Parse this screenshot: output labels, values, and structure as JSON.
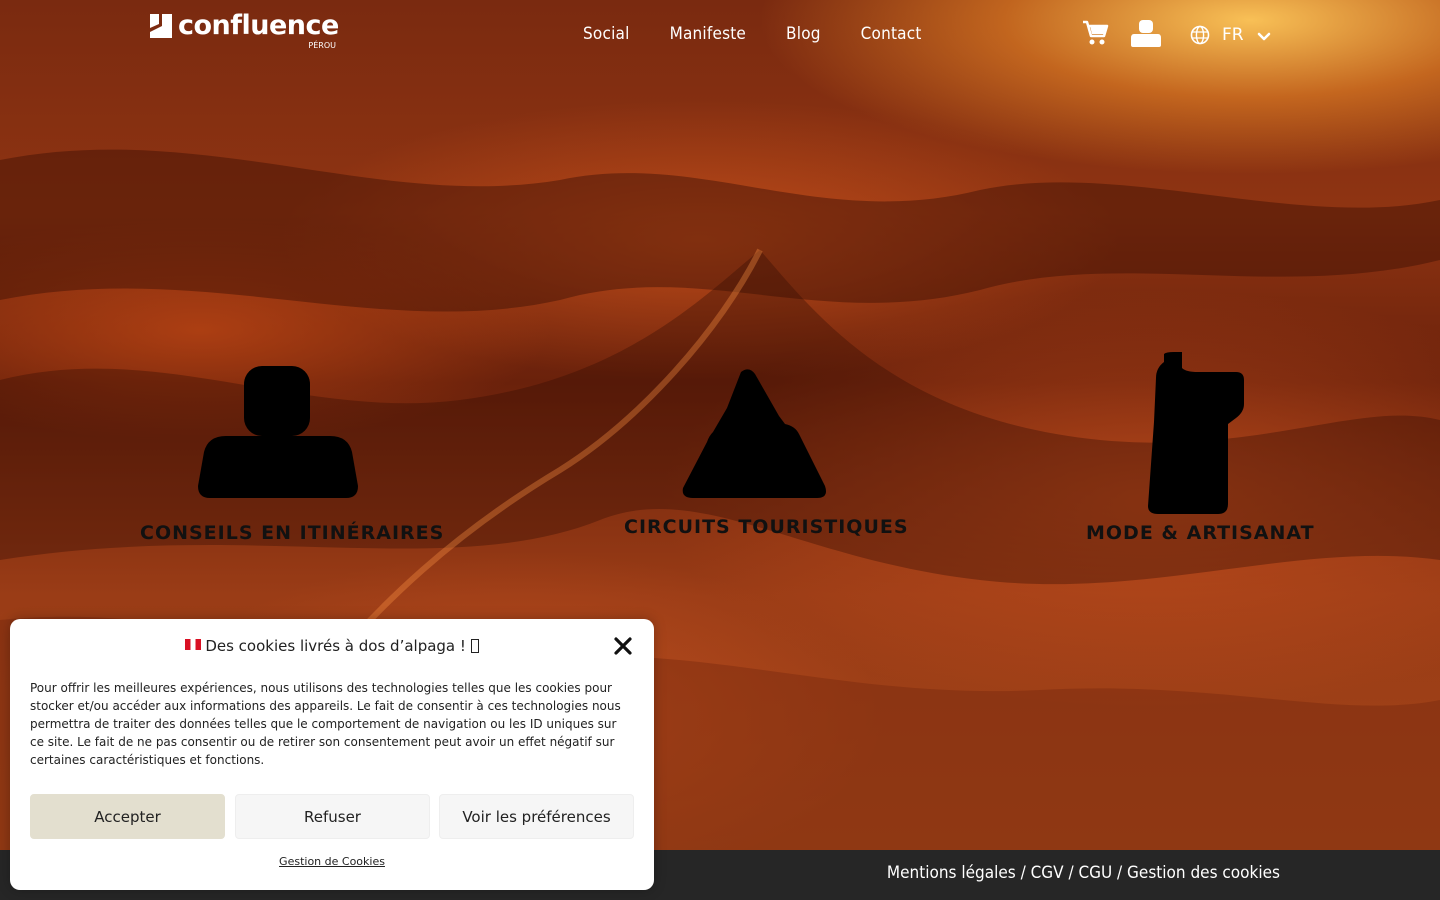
{
  "brand": {
    "name": "confluence",
    "sub": "PÉROU"
  },
  "nav": {
    "items": [
      "Social",
      "Manifeste",
      "Blog",
      "Contact"
    ]
  },
  "header_icons": {
    "cart": "cart-icon",
    "account": "user-icon",
    "language": "globe-icon"
  },
  "lang": {
    "selected": "FR"
  },
  "categories": [
    {
      "label": "CONSEILS EN ITINÉRAIRES",
      "icon": "person-icon"
    },
    {
      "label": "CIRCUITS TOURISTIQUES",
      "icon": "mountain-icon"
    },
    {
      "label": "MODE & ARTISANAT",
      "icon": "garment-icon"
    }
  ],
  "cookie": {
    "title": "Des cookies livrés à dos d’alpaga ! ",
    "text": "Pour offrir les meilleures expériences, nous utilisons des technologies telles que les cookies pour stocker et/ou accéder aux informations des appareils. Le fait de consentir à ces technologies nous permettra de traiter des données telles que le comportement de navigation ou les ID uniques sur ce site. Le fait de ne pas consentir ou de retirer son consentement peut avoir un effet négatif sur certaines caractéristiques et fonctions.",
    "accept": "Accepter",
    "refuse": "Refuser",
    "preferences": "Voir les préférences",
    "manage": "Gestion de Cookies"
  },
  "footer": {
    "links": "Mentions légales / CGV / CGU / Gestion des cookies"
  },
  "colors": {
    "accept_button": "#e3dfcf",
    "footer_bg": "#262626",
    "flag_red": "#d91023"
  }
}
